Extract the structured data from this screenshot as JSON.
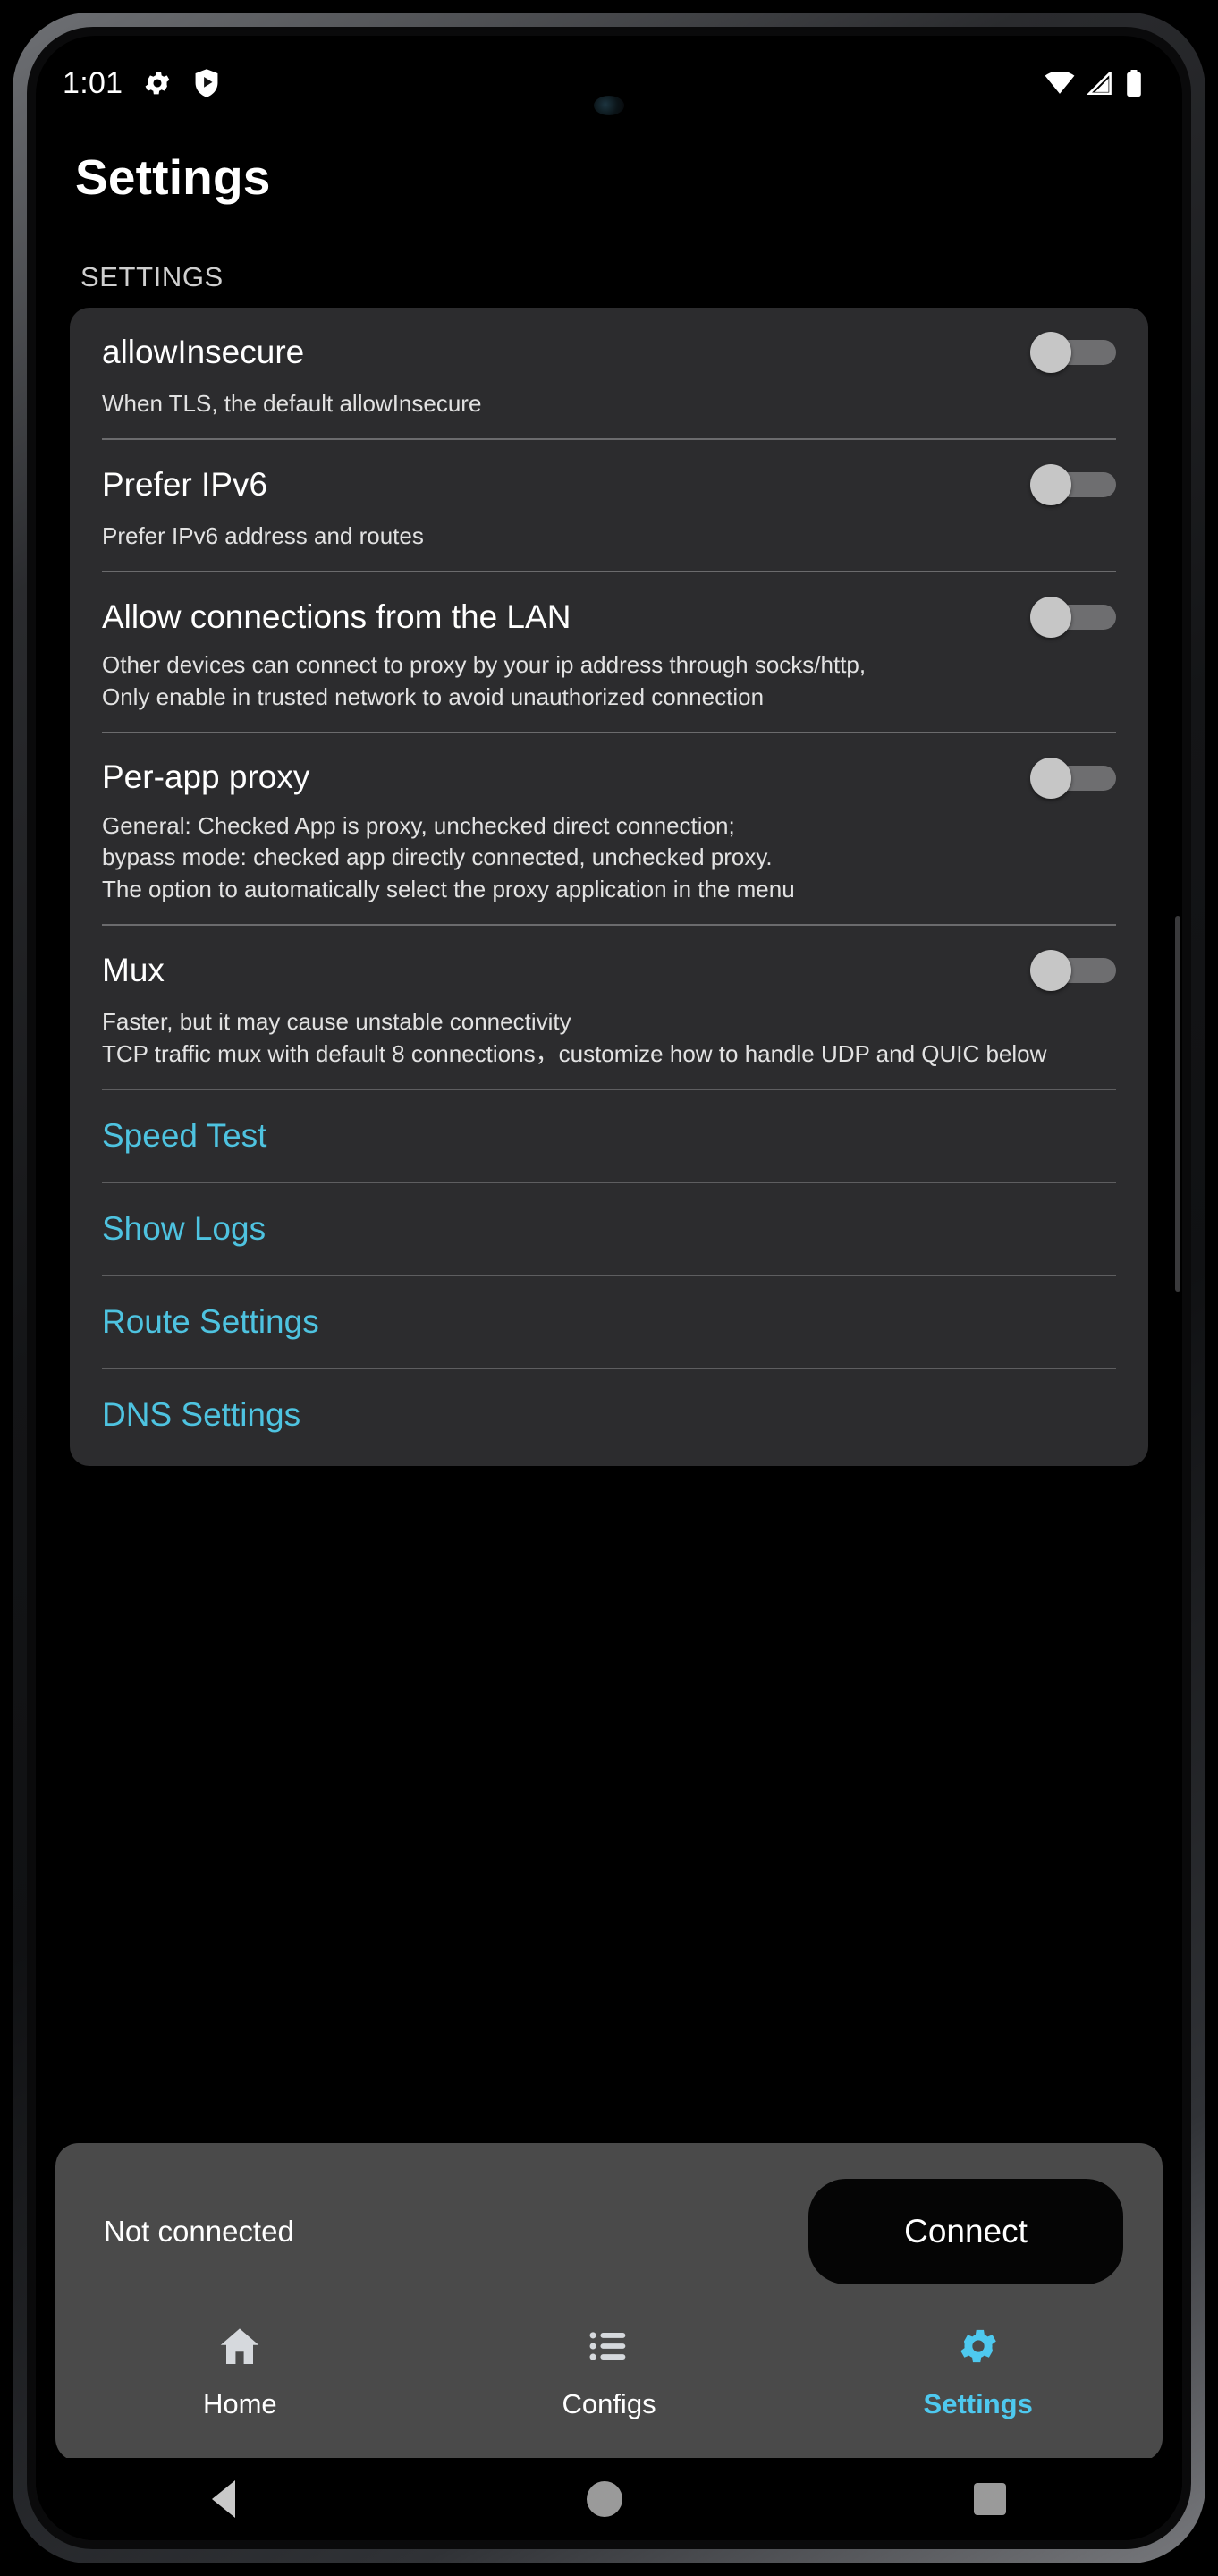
{
  "status_bar": {
    "time": "1:01",
    "left_icons": [
      "gear-icon",
      "shield-play-icon"
    ],
    "right_icons": [
      "wifi-icon",
      "cellular-signal-icon",
      "battery-icon"
    ]
  },
  "header": {
    "title": "Settings"
  },
  "section": {
    "caption": "SETTINGS"
  },
  "settings_rows": [
    {
      "title": "allowInsecure",
      "description": "When TLS, the default allowInsecure",
      "toggle_state": "off"
    },
    {
      "title": "Prefer IPv6",
      "description": "Prefer IPv6 address and routes",
      "toggle_state": "off"
    },
    {
      "title": "Allow connections from the LAN",
      "description": "Other devices can connect to proxy by your ip address through socks/http,\nOnly enable in trusted network to avoid unauthorized connection",
      "toggle_state": "off"
    },
    {
      "title": "Per-app proxy",
      "description": "General: Checked App is proxy, unchecked direct connection;\nbypass mode: checked app directly connected, unchecked proxy.\nThe option to automatically select the proxy application in the menu",
      "toggle_state": "off"
    },
    {
      "title": "Mux",
      "description": "Faster, but it may cause unstable connectivity\nTCP traffic mux with default 8 connections，customize how to handle UDP and QUIC below",
      "toggle_state": "off"
    }
  ],
  "link_rows": [
    {
      "label": "Speed Test"
    },
    {
      "label": "Show Logs"
    },
    {
      "label": "Route Settings"
    },
    {
      "label": "DNS Settings"
    }
  ],
  "bottom_panel": {
    "connection_status": "Not connected",
    "connect_button": "Connect",
    "nav_items": [
      {
        "label": "Home",
        "icon": "home-icon",
        "active": false
      },
      {
        "label": "Configs",
        "icon": "list-icon",
        "active": false
      },
      {
        "label": "Settings",
        "icon": "gear-icon",
        "active": true
      }
    ]
  },
  "system_nav": {
    "back": "back-triangle-icon",
    "home": "home-circle-icon",
    "recents": "recents-square-icon"
  },
  "colors": {
    "accent": "#4ec9ef",
    "link": "#4ec3e0",
    "card_bg": "#2c2c2e",
    "panel_bg": "#4a4a4a",
    "screen_bg": "#000000"
  }
}
